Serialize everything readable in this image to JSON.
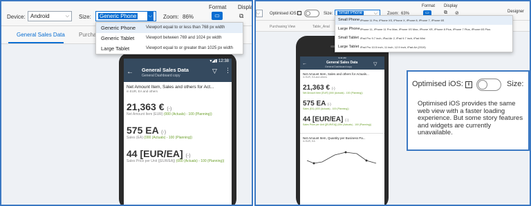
{
  "left": {
    "toolbar": {
      "device_label": "Device:",
      "device_value": "Android",
      "size_label": "Size:",
      "size_value": "Generic Phone",
      "zoom_label": "Zoom:",
      "zoom_value": "86%",
      "format_label": "Format",
      "display_label": "Display"
    },
    "tabs": [
      "General Sales Data",
      "Purcha"
    ],
    "dropdown": [
      {
        "name": "Generic Phone",
        "desc": "Viewport equal to or less than 768 px width"
      },
      {
        "name": "Generic Tablet",
        "desc": "Viewport between 769 and 1024 px width"
      },
      {
        "name": "Large Tablet",
        "desc": "Viewport equal to or greater than 1025 px width"
      }
    ],
    "phone": {
      "time": "12:38",
      "title": "General Sales Data",
      "subtitle": "General Dashboard copy",
      "card_title": "Net Amount Item, Sales and others for Act...",
      "card_sub": "in EUR, EA and others",
      "kpis": [
        {
          "value": "21,363 €",
          "paren": "(-)",
          "label": "Net Amount Item (EUR)",
          "actual": "(000 (Actuals) - 100 (Planning))"
        },
        {
          "value": "575 EA",
          "paren": "(-)",
          "label": "Sales (EA)",
          "actual": "(000 (Actuals) - 100 (Planning))"
        },
        {
          "value": "44 [EUR/EA]",
          "paren": "(-)",
          "label": "Sales Price per Unit ([EUR/EA])",
          "actual": "(000 (Actuals) - 100 (Planning))"
        }
      ]
    }
  },
  "right": {
    "toolbar": {
      "optimised_label": "Optimised iOS:",
      "size_label": "Size:",
      "size_value": "Small Phone",
      "zoom_label": "Zoom:",
      "zoom_value": "63%",
      "format_label": "Format",
      "display_label": "Display",
      "designer_label": "Designer"
    },
    "tabs": [
      "Purchasing View",
      "Table_Anal"
    ],
    "dropdown": [
      {
        "name": "Small Phone",
        "desc": "iPhone 11 Pro, iPhone XS, iPhone X, iPhone 8, iPhone 7, iPhone 6S"
      },
      {
        "name": "Large Phone",
        "desc": "iPhone 11, iPhone 11 Pro Max, iPhone XS Max, iPhone XR, iPhone 8 Plus, iPhone 7 Plus, iPhone 6S Plus"
      },
      {
        "name": "Small Tablet",
        "desc": "iPad Pro 9.7 inch, iPad Air 2, iPad 9.7 inch, iPad Mini"
      },
      {
        "name": "Large Tablet",
        "desc": "iPad Pro 10.5 inch, 11 inch, 12.9 inch, iPad Air (2019)"
      }
    ],
    "phone": {
      "time": "9:41 AM",
      "title": "General Sales Data",
      "subtitle": "General Dashboard copy",
      "card_title": "Net Amount Item, Sales and others for Actuals...",
      "card_sub": "in EUR, EA and others",
      "kpis": [
        {
          "value": "21,363 €",
          "paren": "(-)",
          "label": "Net Amount Item (EUR) (000 (Actuals) - 100 (Planning))"
        },
        {
          "value": "575 EA",
          "paren": "(-)",
          "label": "Sales (EA) (000 (Actuals) - 100 (Planning))"
        },
        {
          "value": "44 [EUR/EA]",
          "paren": "(-)",
          "label": "Sales Price per Unit ([EUR/EA]) (000 (Actuals) - 100 (Planning))"
        }
      ],
      "card2_title": "Net Amount Item, Quantity per Business Pa...",
      "card2_sub": "in EUR, EA"
    },
    "zoom": {
      "label": "Optimised iOS:",
      "size_label": "Size:",
      "text": "Optimised iOS provides the same web view with a faster loading experience. But some story features and widgets are currently unavailable."
    }
  }
}
